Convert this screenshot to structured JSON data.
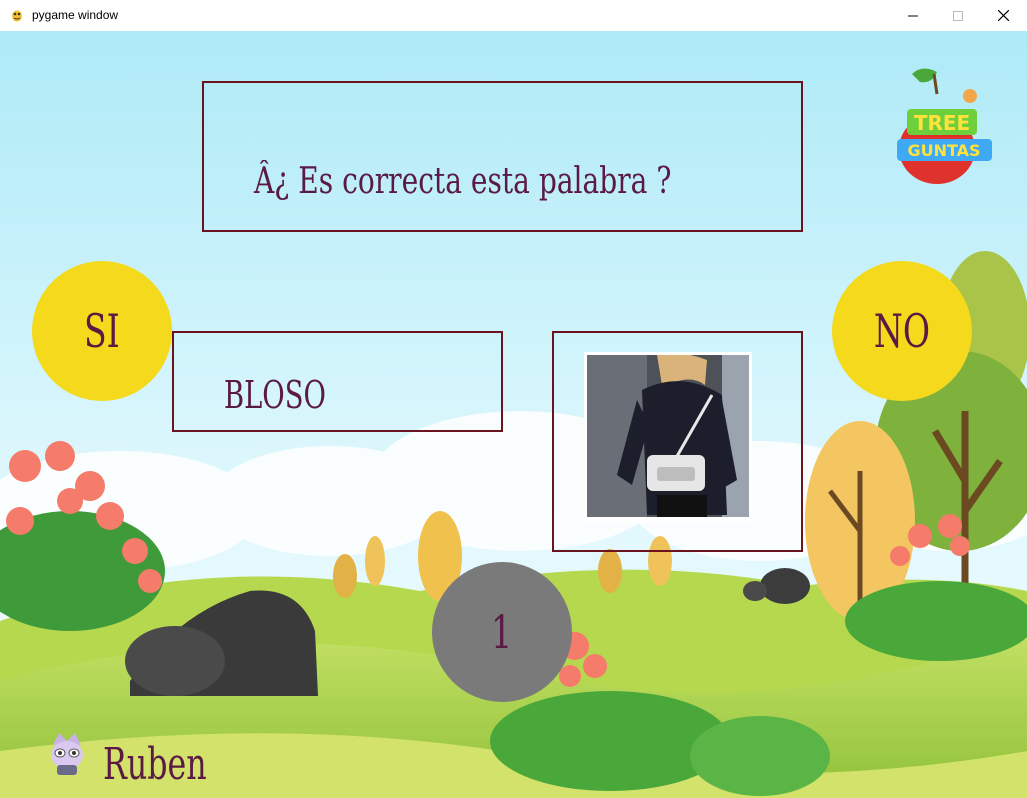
{
  "window": {
    "title": "pygame window",
    "icons": [
      "pygame-snake-icon",
      "minimize-icon",
      "maximize-icon",
      "close-icon"
    ]
  },
  "game": {
    "question": "Â¿ Es correcta esta palabra ?",
    "word": "BLOSO",
    "yes_label": "SI",
    "no_label": "NO",
    "counter": "1",
    "player_name": "Ruben",
    "logo_text_top": "TREE",
    "logo_text_bottom": "GUNTAS",
    "image_subject": "woman with white crossbody bag"
  },
  "colors": {
    "sky": "#bfeefb",
    "frame_border": "#6b1420",
    "text": "#5a1a44",
    "yes_no_buttons": "#f5d91c",
    "counter_circle": "#7a7a7a",
    "grass": "#a6d14a"
  }
}
